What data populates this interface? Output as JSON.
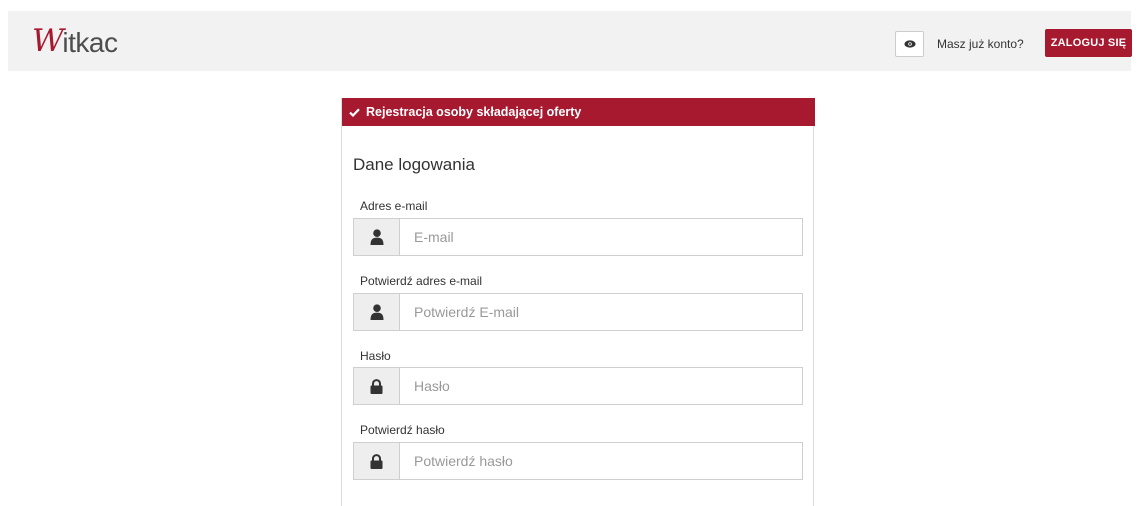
{
  "header": {
    "logo_first": "W",
    "logo_rest": "itkac",
    "have_account": "Masz już konto?",
    "login_label": "ZALOGUJ SIĘ"
  },
  "form": {
    "header": "Rejestracja osoby składającej oferty",
    "section_title": "Dane logowania",
    "fields": [
      {
        "label": "Adres e-mail",
        "placeholder": "E-mail",
        "icon": "user-icon"
      },
      {
        "label": "Potwierdź adres e-mail",
        "placeholder": "Potwierdź E-mail",
        "icon": "user-icon"
      },
      {
        "label": "Hasło",
        "placeholder": "Hasło",
        "icon": "lock-icon"
      },
      {
        "label": "Potwierdź hasło",
        "placeholder": "Potwierdź hasło",
        "icon": "lock-icon"
      }
    ]
  },
  "colors": {
    "brand": "#a6192e",
    "topbar": "#f2f2f2"
  }
}
